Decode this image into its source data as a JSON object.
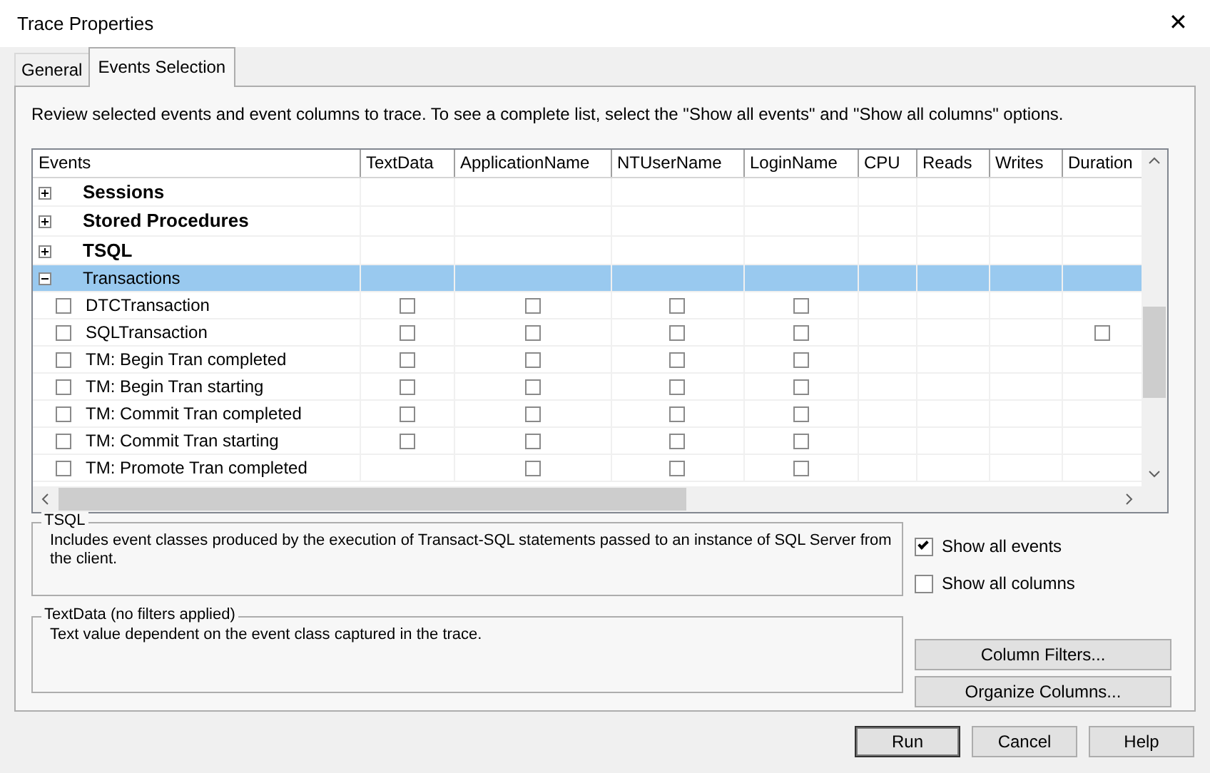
{
  "window": {
    "title": "Trace Properties",
    "close": "✕"
  },
  "tabs": [
    {
      "label": "General",
      "selected": false
    },
    {
      "label": "Events Selection",
      "selected": true
    }
  ],
  "intro": "Review selected events and event columns to trace. To see a complete list, select the \"Show all events\" and \"Show all columns\" options.",
  "grid": {
    "columns": [
      "Events",
      "TextData",
      "ApplicationName",
      "NTUserName",
      "LoginName",
      "CPU",
      "Reads",
      "Writes",
      "Duration"
    ],
    "rows": [
      {
        "kind": "category",
        "label": "Sessions",
        "expanded": false,
        "emphasized": true,
        "selected": false
      },
      {
        "kind": "category",
        "label": "Stored Procedures",
        "expanded": false,
        "emphasized": true,
        "selected": false
      },
      {
        "kind": "category",
        "label": "TSQL",
        "expanded": false,
        "emphasized": true,
        "selected": false
      },
      {
        "kind": "category",
        "label": "Transactions",
        "expanded": true,
        "emphasized": false,
        "selected": true
      },
      {
        "kind": "event",
        "label": "DTCTransaction",
        "checked": false,
        "cells": [
          false,
          false,
          false,
          false,
          null,
          null,
          null,
          null
        ]
      },
      {
        "kind": "event",
        "label": "SQLTransaction",
        "checked": false,
        "cells": [
          false,
          false,
          false,
          false,
          null,
          null,
          null,
          false
        ]
      },
      {
        "kind": "event",
        "label": "TM: Begin Tran completed",
        "checked": false,
        "cells": [
          false,
          false,
          false,
          false,
          null,
          null,
          null,
          null
        ]
      },
      {
        "kind": "event",
        "label": "TM: Begin Tran starting",
        "checked": false,
        "cells": [
          false,
          false,
          false,
          false,
          null,
          null,
          null,
          null
        ]
      },
      {
        "kind": "event",
        "label": "TM: Commit Tran completed",
        "checked": false,
        "cells": [
          false,
          false,
          false,
          false,
          null,
          null,
          null,
          null
        ]
      },
      {
        "kind": "event",
        "label": "TM: Commit Tran starting",
        "checked": false,
        "cells": [
          false,
          false,
          false,
          false,
          null,
          null,
          null,
          null
        ]
      },
      {
        "kind": "event",
        "label": "TM: Promote Tran completed",
        "checked": false,
        "cells": [
          null,
          false,
          false,
          false,
          null,
          null,
          null,
          null
        ]
      }
    ]
  },
  "event_description": {
    "title": "TSQL",
    "text": "Includes event classes produced by the execution of Transact-SQL statements passed to an instance of SQL Server from the client."
  },
  "column_description": {
    "title": "TextData (no filters applied)",
    "text": "Text value dependent on the event class captured in the trace."
  },
  "options": [
    {
      "label": "Show all events",
      "checked": true
    },
    {
      "label": "Show all columns",
      "checked": false
    }
  ],
  "side_buttons": [
    "Column Filters...",
    "Organize Columns..."
  ],
  "buttons": [
    "Run",
    "Cancel",
    "Help"
  ]
}
